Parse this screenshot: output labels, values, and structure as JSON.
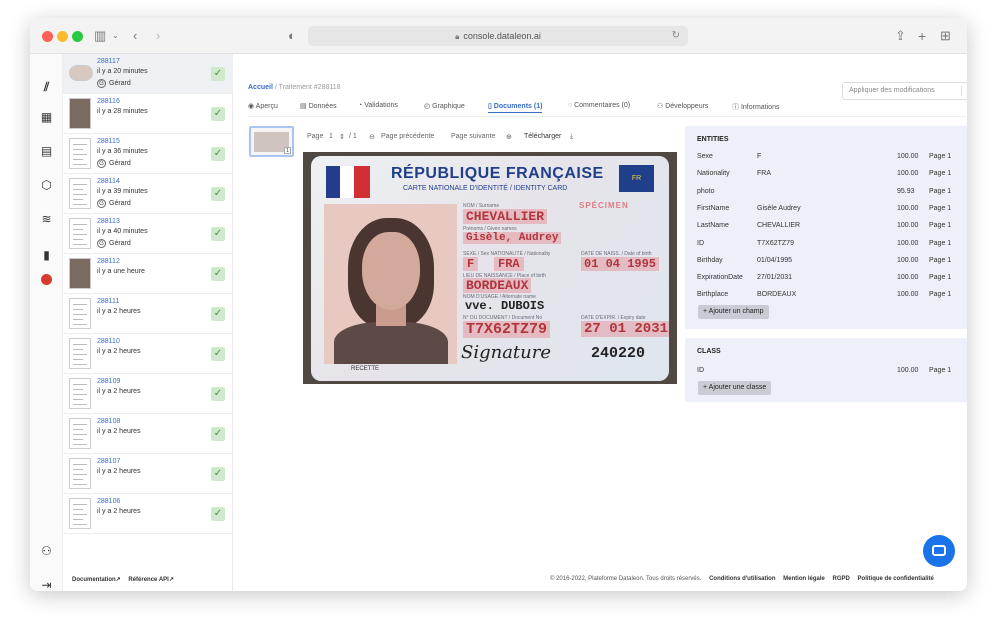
{
  "browser": {
    "url": "console.dataleon.ai"
  },
  "sidebar_docs": [
    {
      "id": "288117",
      "when": "il y a 20 minutes",
      "user": "Gérard",
      "thumb": "card",
      "selected": true
    },
    {
      "id": "288116",
      "when": "il y a 28 minutes",
      "user": "",
      "thumb": "photo"
    },
    {
      "id": "288115",
      "when": "il y a 36 minutes",
      "user": "Gérard",
      "thumb": "doc"
    },
    {
      "id": "288114",
      "when": "il y a 39 minutes",
      "user": "Gérard",
      "thumb": "doc"
    },
    {
      "id": "288113",
      "when": "il y a 40 minutes",
      "user": "Gérard",
      "thumb": "doc"
    },
    {
      "id": "288112",
      "when": "il y a une heure",
      "user": "",
      "thumb": "photo"
    },
    {
      "id": "288111",
      "when": "il y a 2 heures",
      "user": "",
      "thumb": "doc"
    },
    {
      "id": "288110",
      "when": "il y a 2 heures",
      "user": "",
      "thumb": "doc"
    },
    {
      "id": "288109",
      "when": "il y a 2 heures",
      "user": "",
      "thumb": "doc"
    },
    {
      "id": "288108",
      "when": "il y a 2 heures",
      "user": "",
      "thumb": "doc"
    },
    {
      "id": "288107",
      "when": "il y a 2 heures",
      "user": "",
      "thumb": "doc"
    },
    {
      "id": "288106",
      "when": "il y a 2 heures",
      "user": "",
      "thumb": "doc"
    }
  ],
  "breadcrumb": {
    "home": "Accueil",
    "sep": "/",
    "current": "Traitement #288118"
  },
  "apply_button": "Appliquer des modifications",
  "tabs": [
    "Aperçu",
    "Données",
    "Validations",
    "Graphique",
    "Documents (1)",
    "Commentaires (0)",
    "Développeurs",
    "Informations"
  ],
  "tab_icons": [
    "eye-icon",
    "database-icon",
    "check-circle-icon",
    "graph-icon",
    "document-icon",
    "comment-icon",
    "user-icon",
    "info-icon"
  ],
  "active_tab": 4,
  "viewer": {
    "page_label": "Page",
    "page_current": "1",
    "page_total": "/ 1",
    "prev": "Page précédente",
    "next": "Page suivante",
    "download": "Télécharger"
  },
  "id_card": {
    "title": "RÉPUBLIQUE FRANÇAISE",
    "subtitle": "CARTE NATIONALE D'IDENTITÉ / IDENTITY CARD",
    "eu_code": "FR",
    "specimen": "SPÉCIMEN",
    "label_surname": "NOM / Surname",
    "surname": "CHEVALLIER",
    "label_given": "Prénoms / Given names",
    "given": "Gisèle, Audrey",
    "label_sex_nat": "SEXE / Sex   NATIONALITÉ / Nationality",
    "sex": "F",
    "nationality": "FRA",
    "label_birth": "DATE DE NAISS. / Date of birth",
    "birth_date": "01 04 1995",
    "label_place": "LIEU DE NAISSANCE / Place of birth",
    "birth_place": "BORDEAUX",
    "label_usage": "NOM D'USAGE / Alternate name",
    "usage_name": "vve. DUBOIS",
    "label_docno": "N° DU DOCUMENT / Document No",
    "doc_no": "T7X62TZ79",
    "label_expiry": "DATE D'EXPIR. / Expiry date",
    "expiry": "27 01 2031",
    "signature": "Signature",
    "mrz": "240220",
    "recette": "RECETTE"
  },
  "entities_panel": {
    "title": "ENTITIES",
    "rows": [
      {
        "name": "Sexe",
        "value": "F",
        "score": "100.00",
        "page": "Page 1"
      },
      {
        "name": "Nationality",
        "value": "FRA",
        "score": "100.00",
        "page": "Page 1"
      },
      {
        "name": "photo",
        "value": "",
        "score": "95.93",
        "page": "Page 1"
      },
      {
        "name": "FirstName",
        "value": "Gisèle Audrey",
        "score": "100.00",
        "page": "Page 1"
      },
      {
        "name": "LastName",
        "value": "CHEVALLIER",
        "score": "100.00",
        "page": "Page 1"
      },
      {
        "name": "ID",
        "value": "T7X62TZ79",
        "score": "100.00",
        "page": "Page 1"
      },
      {
        "name": "Birthday",
        "value": "01/04/1995",
        "score": "100.00",
        "page": "Page 1"
      },
      {
        "name": "ExpirationDate",
        "value": "27/01/2031",
        "score": "100.00",
        "page": "Page 1"
      },
      {
        "name": "Birthplace",
        "value": "BORDEAUX",
        "score": "100.00",
        "page": "Page 1"
      }
    ],
    "add_label": "+ Ajouter un champ"
  },
  "class_panel": {
    "title": "CLASS",
    "rows": [
      {
        "name": "ID",
        "value": "",
        "score": "100.00",
        "page": "Page 1"
      }
    ],
    "add_label": "+ Ajouter une classe"
  },
  "footer": {
    "docs": "Documentation",
    "api": "Référence API",
    "copyright": "© 2016-2022, Plateforme Dataleon. Tous droits réservés.",
    "terms": "Conditions d'utilisation",
    "legal": "Mention légale",
    "rgpd": "RGPD",
    "privacy": "Politique de confidentialité"
  },
  "colors": {
    "accent": "#3b6cc7",
    "panel_bg": "#edf0f8",
    "check_bg": "#cfe9cc",
    "highlight": "#e68791",
    "fab": "#1a73e8"
  }
}
